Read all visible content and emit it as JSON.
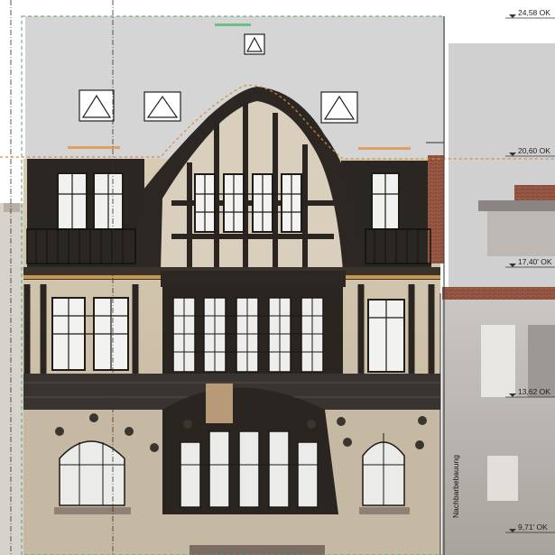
{
  "levels": [
    {
      "label": "24,58 OK"
    },
    {
      "label": "20,60 OK"
    },
    {
      "label": "17,40' OK"
    },
    {
      "label": "13,62 OK"
    },
    {
      "label": "9,71' OK"
    }
  ],
  "neighbor_label": "Nachbarbebauung",
  "colors": {
    "roof_fill": "#d5d5d5",
    "timber": "#2a2520",
    "render": "#cfc3ae",
    "dashed_orange": "#d98a3a",
    "dashed_green": "#5aa36c",
    "neighbor": "#b9b5b1"
  }
}
